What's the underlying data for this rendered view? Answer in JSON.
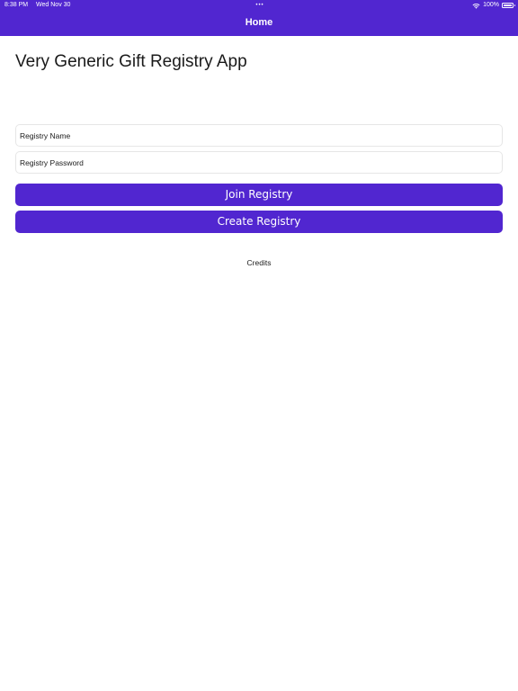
{
  "status_bar": {
    "time": "8:38 PM",
    "date": "Wed Nov 30",
    "dots": "•••",
    "battery": "100%",
    "wifi_icon": "wifi-icon",
    "battery_icon": "battery-icon"
  },
  "nav": {
    "title": "Home"
  },
  "main": {
    "title": "Very Generic Gift Registry App",
    "registry_name_placeholder": "Registry Name",
    "registry_password_placeholder": "Registry Password",
    "join_label": "Join Registry",
    "create_label": "Create Registry",
    "credits_label": "Credits"
  },
  "colors": {
    "accent": "#5126d0",
    "background": "#ffffff",
    "text": "#1a1a1a"
  }
}
